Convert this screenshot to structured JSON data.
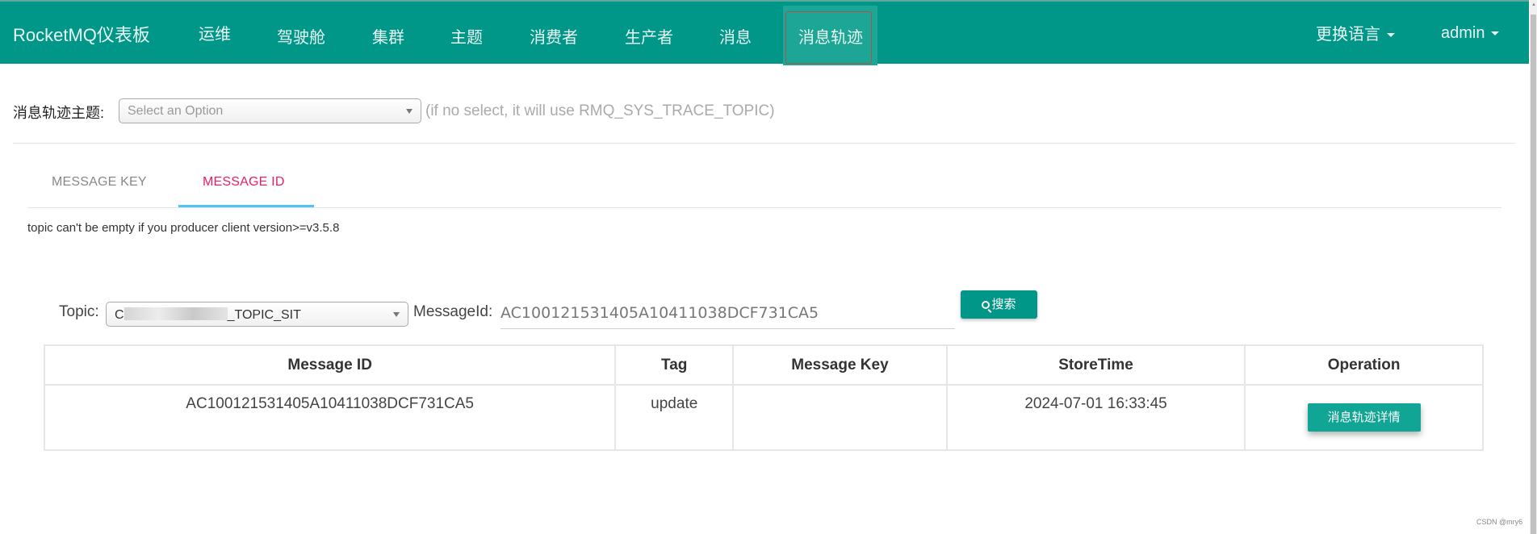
{
  "header": {
    "brand": "RocketMQ仪表板",
    "nav": [
      {
        "label": "运维"
      },
      {
        "label": "驾驶舱"
      },
      {
        "label": "集群"
      },
      {
        "label": "主题"
      },
      {
        "label": "消费者"
      },
      {
        "label": "生产者"
      },
      {
        "label": "消息"
      },
      {
        "label": "消息轨迹",
        "active": true
      }
    ],
    "language_menu": "更换语言",
    "user_menu": "admin"
  },
  "trace_topic": {
    "label": "消息轨迹主题:",
    "select_placeholder": "Select an Option",
    "hint": "(if no select, it will use RMQ_SYS_TRACE_TOPIC)"
  },
  "tabs": [
    {
      "label": "MESSAGE KEY",
      "active": false
    },
    {
      "label": "MESSAGE ID",
      "active": true
    }
  ],
  "note": "topic can't be empty if you producer client version>=v3.5.8",
  "query": {
    "topic_label": "Topic:",
    "topic_value_prefix": "C",
    "topic_value_suffix": "_TOPIC_SIT",
    "message_id_label": "MessageId:",
    "message_id_value": "AC100121531405A10411038DCF731CA5",
    "search_label": "搜索"
  },
  "table": {
    "columns": [
      "Message ID",
      "Tag",
      "Message Key",
      "StoreTime",
      "Operation"
    ],
    "rows": [
      {
        "message_id": "AC100121531405A10411038DCF731CA5",
        "tag": "update",
        "message_key": "",
        "store_time": "2024-07-01 16:33:45",
        "operation_label": "消息轨迹详情"
      }
    ]
  },
  "colors": {
    "primary": "#009688",
    "active_tab": "#e91e63",
    "tab_indicator": "#4fc3f7"
  },
  "watermark": "CSDN @mry6"
}
